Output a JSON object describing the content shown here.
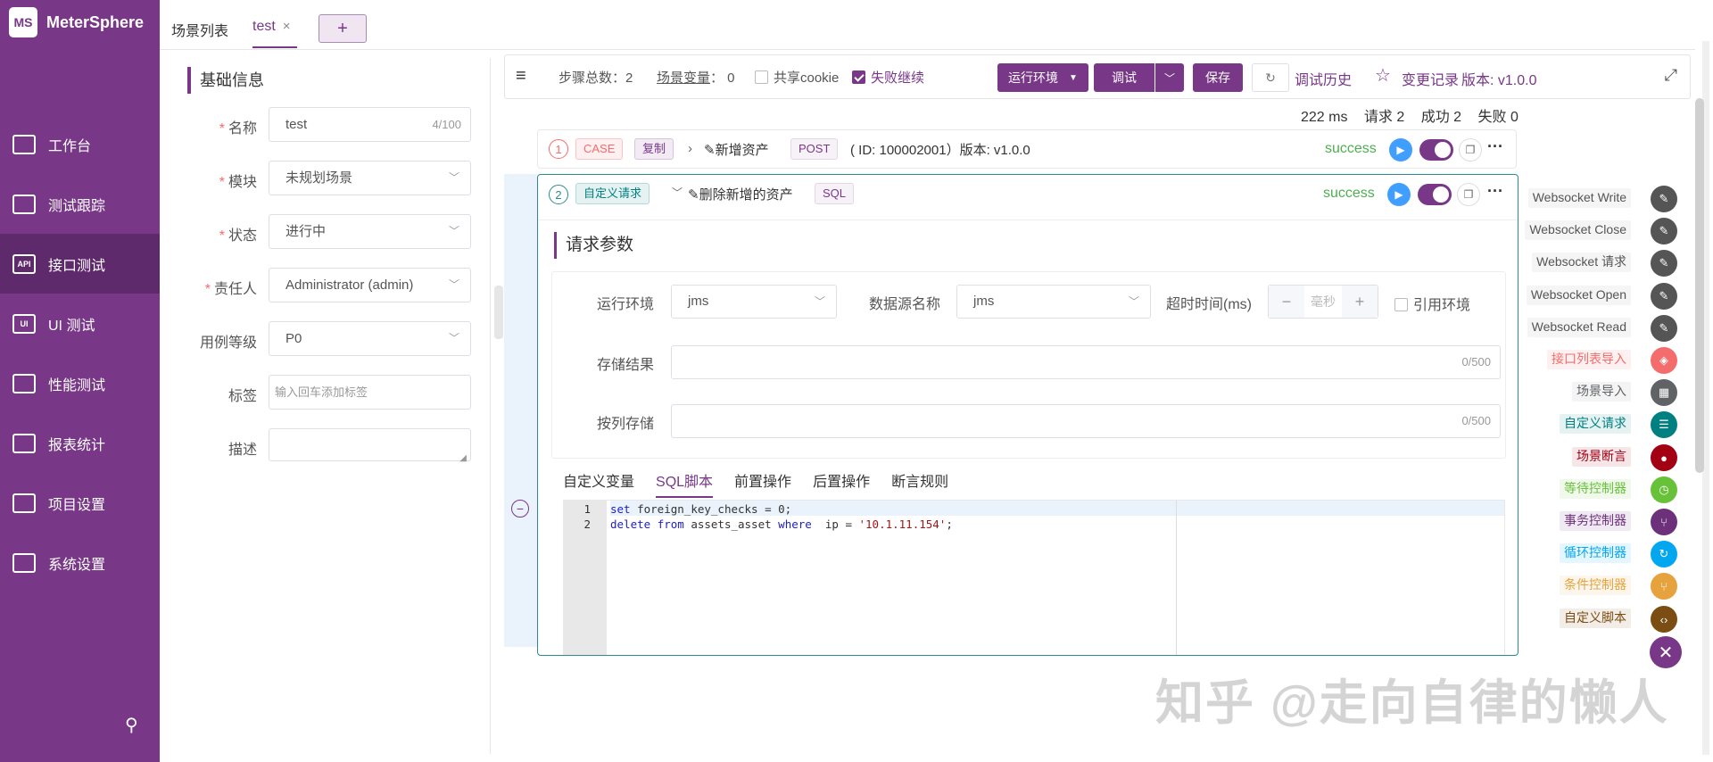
{
  "app": {
    "logo_mark": "MS",
    "name": "MeterSphere"
  },
  "nav": [
    {
      "label": "工作台",
      "icon": "monitor-icon",
      "glyph": ""
    },
    {
      "label": "测试跟踪",
      "icon": "clipboard-icon",
      "glyph": ""
    },
    {
      "label": "接口测试",
      "icon": "api-icon",
      "glyph": "API",
      "active": true
    },
    {
      "label": "UI 测试",
      "icon": "ui-icon",
      "glyph": "UI"
    },
    {
      "label": "性能测试",
      "icon": "chart-icon",
      "glyph": ""
    },
    {
      "label": "报表统计",
      "icon": "report-icon",
      "glyph": ""
    },
    {
      "label": "项目设置",
      "icon": "folder-icon",
      "glyph": ""
    },
    {
      "label": "系统设置",
      "icon": "gear-icon",
      "glyph": ""
    }
  ],
  "tabs": {
    "list": "场景列表",
    "active": "test",
    "close": "×",
    "add": "+"
  },
  "basic": {
    "title": "基础信息",
    "name_label": "名称",
    "name_value": "test",
    "name_count": "4/100",
    "module_label": "模块",
    "module_value": "未规划场景",
    "status_label": "状态",
    "status_value": "进行中",
    "owner_label": "责任人",
    "owner_value": "Administrator (admin)",
    "level_label": "用例等级",
    "level_value": "P0",
    "tags_label": "标签",
    "tags_placeholder": "输入回车添加标签",
    "desc_label": "描述"
  },
  "toolbar": {
    "steps_label": "步骤总数：",
    "steps_value": "2",
    "vars_label": "场景变量",
    "vars_value": "：  0",
    "share_cookie": "共享cookie",
    "continue_on_fail": "失败继续",
    "env_btn": "运行环境",
    "debug_btn": "调试",
    "save_btn": "保存",
    "debug_history": "调试历史",
    "change_log": "变更记录",
    "version": "版本: v1.0.0"
  },
  "stats": {
    "time": "222 ms",
    "requests": "请求 2",
    "success": "成功 2",
    "fail": "失败 0"
  },
  "step1": {
    "num": "1",
    "type_tag": "CASE",
    "copy_tag": "复制",
    "name": "新增资产",
    "method": "POST",
    "info": "( ID: 100002001）版本: v1.0.0",
    "status": "success"
  },
  "step2": {
    "num": "2",
    "type_tag": "自定义请求",
    "name": "删除新增的资产",
    "kind": "SQL",
    "status": "success",
    "req_title": "请求参数",
    "env_label": "运行环境",
    "env_value": "jms",
    "ds_label": "数据源名称",
    "ds_value": "jms",
    "timeout_label": "超时时间(ms)",
    "timeout_placeholder": "毫秒",
    "ref_env": "引用环境",
    "store_label": "存储结果",
    "store_count": "0/500",
    "col_label": "按列存储",
    "col_count": "0/500",
    "subtabs": [
      "自定义变量",
      "SQL脚本",
      "前置操作",
      "后置操作",
      "断言规则"
    ],
    "code": [
      {
        "ln": "1",
        "parts": [
          [
            "kw",
            "set"
          ],
          [
            "",
            "foreign_key_checks = 0;"
          ]
        ]
      },
      {
        "ln": "2",
        "parts": [
          [
            "kw",
            "delete"
          ],
          [
            "",
            " "
          ],
          [
            "kw",
            "from"
          ],
          [
            "",
            ""
          ],
          [
            "",
            "assets_asset "
          ],
          [
            "kw",
            "where"
          ],
          [
            "",
            " ip = "
          ],
          [
            "str",
            "'10.1.11.154'"
          ],
          [
            "",
            ";"
          ]
        ]
      }
    ]
  },
  "palette": [
    {
      "label": "Websocket Write",
      "color": "#555555",
      "icon": "pen-icon",
      "glyph": "✎",
      "text": "#555555",
      "bg": "#f5f5f5"
    },
    {
      "label": "Websocket Close",
      "color": "#555555",
      "icon": "pen-icon",
      "glyph": "✎",
      "text": "#555555",
      "bg": "#f5f5f5"
    },
    {
      "label": "Websocket 请求",
      "color": "#555555",
      "icon": "pen-icon",
      "glyph": "✎",
      "text": "#555555",
      "bg": "#f5f5f5"
    },
    {
      "label": "Websocket Open",
      "color": "#555555",
      "icon": "pen-icon",
      "glyph": "✎",
      "text": "#555555",
      "bg": "#f5f5f5"
    },
    {
      "label": "Websocket Read",
      "color": "#555555",
      "icon": "pen-icon",
      "glyph": "✎",
      "text": "#555555",
      "bg": "#f5f5f5"
    },
    {
      "label": "接口列表导入",
      "color": "#f56c6c",
      "icon": "import-icon",
      "glyph": "◈",
      "text": "#f56c6c",
      "bg": "#fdf0f0"
    },
    {
      "label": "场景导入",
      "color": "#606266",
      "icon": "clapper-icon",
      "glyph": "▦",
      "text": "#606266",
      "bg": "#f4f4f5"
    },
    {
      "label": "自定义请求",
      "color": "#008080",
      "icon": "sliders-icon",
      "glyph": "☰",
      "text": "#008080",
      "bg": "#e6f2f2"
    },
    {
      "label": "场景断言",
      "color": "#a30014",
      "icon": "assert-icon",
      "glyph": "●",
      "text": "#a30014",
      "bg": "#f6e6e8"
    },
    {
      "label": "等待控制器",
      "color": "#67c23a",
      "icon": "clock-icon",
      "glyph": "◷",
      "text": "#67c23a",
      "bg": "#f0f9eb"
    },
    {
      "label": "事务控制器",
      "color": "#6d317c",
      "icon": "fork-icon",
      "glyph": "⑂",
      "text": "#6d317c",
      "bg": "#f0eaf2"
    },
    {
      "label": "循环控制器",
      "color": "#02a7f0",
      "icon": "loop-icon",
      "glyph": "↻",
      "text": "#02a7f0",
      "bg": "#e6f6fe"
    },
    {
      "label": "条件控制器",
      "color": "#e6a23c",
      "icon": "branch-icon",
      "glyph": "⑂",
      "text": "#e6a23c",
      "bg": "#fdf6ec"
    },
    {
      "label": "自定义脚本",
      "color": "#7b4d12",
      "icon": "code-icon",
      "glyph": "‹›",
      "text": "#7b4d12",
      "bg": "#f2ede7"
    }
  ],
  "watermark": "知乎 @走向自律的懒人"
}
